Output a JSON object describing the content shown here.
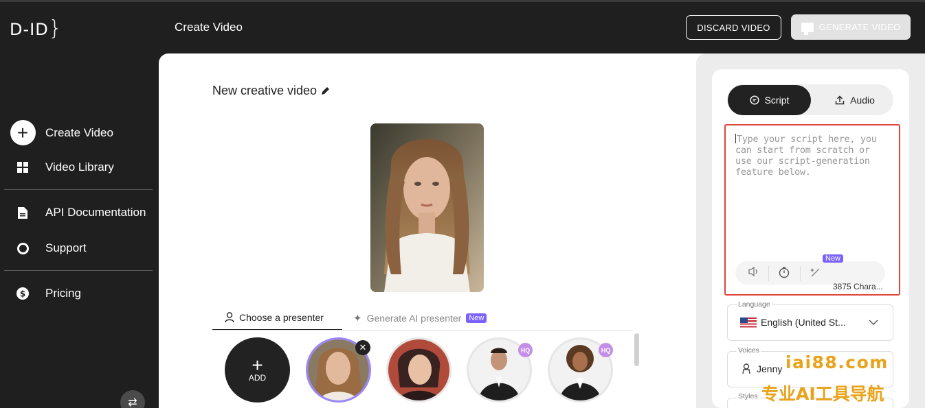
{
  "app": {
    "logo_text": "D-ID",
    "page_title": "Create Video"
  },
  "header": {
    "discard_label": "DISCARD VIDEO",
    "generate_label": "GENERATE VIDEO",
    "generate_disabled": true
  },
  "sidebar": {
    "items": [
      {
        "label": "Create Video",
        "icon": "plus-circle-icon"
      },
      {
        "label": "Video Library",
        "icon": "grid-icon"
      },
      {
        "label": "API Documentation",
        "icon": "document-icon"
      },
      {
        "label": "Support",
        "icon": "lifebuoy-icon"
      },
      {
        "label": "Pricing",
        "icon": "dollar-icon"
      }
    ]
  },
  "editor": {
    "video_name": "New creative video",
    "tabs": [
      {
        "label": "Choose a presenter",
        "active": true
      },
      {
        "label": "Generate AI presenter",
        "active": false,
        "badge": "New"
      }
    ],
    "add_label": "ADD",
    "presenters": [
      {
        "name": "long-hair-woman",
        "selected": true,
        "removable": true
      },
      {
        "name": "dark-hair-woman",
        "badge": ""
      },
      {
        "name": "man-in-suit",
        "badge": "HQ"
      },
      {
        "name": "woman-curly-hair",
        "badge": "HQ"
      }
    ]
  },
  "script_panel": {
    "tabs": [
      {
        "label": "Script",
        "active": true
      },
      {
        "label": "Audio",
        "active": false
      }
    ],
    "placeholder": "Type your script here, you can start from scratch or use our script-generation feature below.",
    "tool_new_badge": "New",
    "char_count": "3875 Chara...",
    "language": {
      "label": "Language",
      "value": "English (United St..."
    },
    "voices": {
      "label": "Voices",
      "value": "Jenny"
    },
    "styles": {
      "label": "Styles"
    }
  },
  "watermark": {
    "line1": "iai88.com",
    "line2": "专业AI工具导航"
  },
  "colors": {
    "accent": "#7b61ff",
    "highlight_border": "#e0453d",
    "sidebar_bg": "#1f1f1f"
  }
}
